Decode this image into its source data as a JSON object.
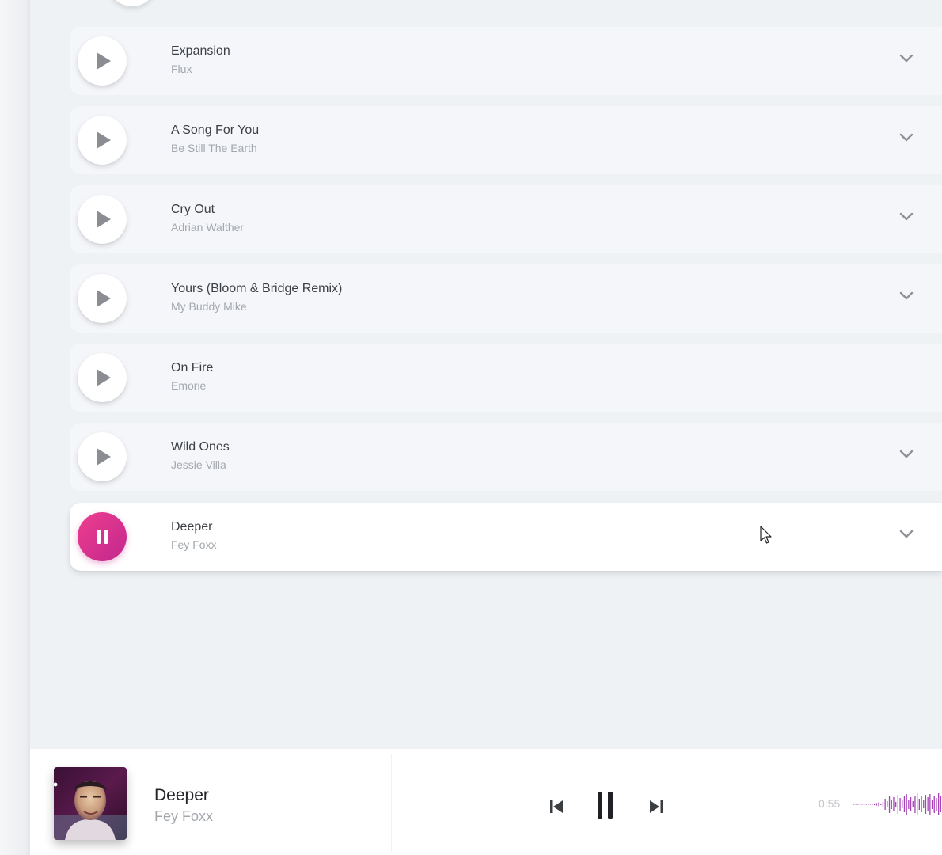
{
  "tracks": [
    {
      "title": "Expansion",
      "artist": "Flux",
      "has_chevron": true
    },
    {
      "title": "A Song For You",
      "artist": "Be Still The Earth",
      "has_chevron": true
    },
    {
      "title": "Cry Out",
      "artist": "Adrian Walther",
      "has_chevron": true
    },
    {
      "title": "Yours (Bloom & Bridge Remix)",
      "artist": "My Buddy Mike",
      "has_chevron": true
    },
    {
      "title": "On Fire",
      "artist": "Emorie",
      "has_chevron": false
    },
    {
      "title": "Wild Ones",
      "artist": "Jessie Villa",
      "has_chevron": true
    },
    {
      "title": "Deeper",
      "artist": "Fey Foxx",
      "has_chevron": true,
      "playing": true
    }
  ],
  "now_playing": {
    "title": "Deeper",
    "artist": "Fey Foxx",
    "elapsed": "0:55"
  },
  "icons": {
    "play": "play-icon",
    "pause": "pause-icon",
    "expand": "chevron-down-icon",
    "previous": "skip-previous-icon",
    "next": "skip-next-icon"
  },
  "colors": {
    "accent_start": "#ee3e8f",
    "accent_end": "#c2278d",
    "waveform": "#9b2fae"
  }
}
